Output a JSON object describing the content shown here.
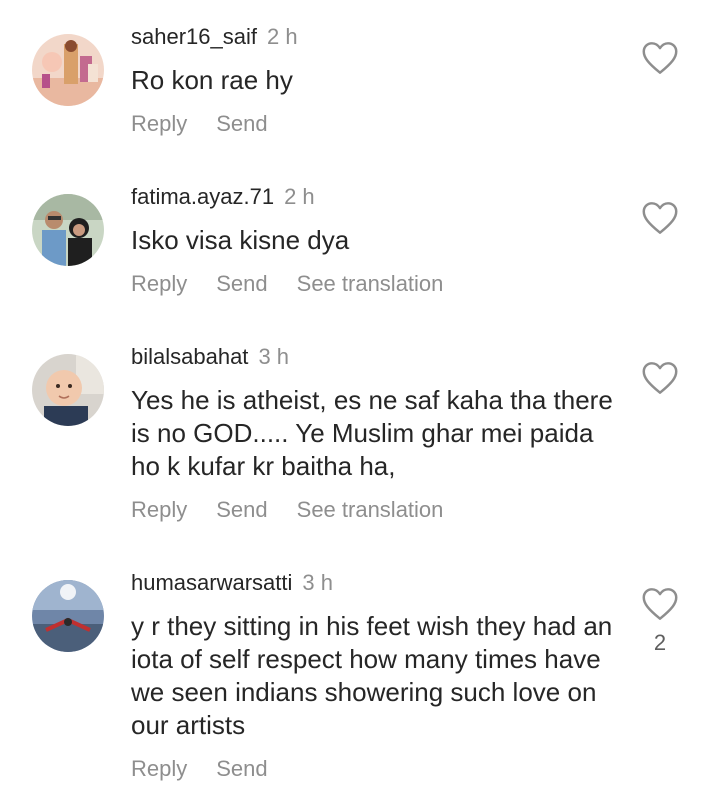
{
  "comments": [
    {
      "username": "saher16_saif",
      "time": "2 h",
      "text": "Ro kon rae hy",
      "actions": [
        "Reply",
        "Send"
      ],
      "like_count": ""
    },
    {
      "username": "fatima.ayaz.71",
      "time": "2 h",
      "text": "Isko visa kisne dya",
      "actions": [
        "Reply",
        "Send",
        "See translation"
      ],
      "like_count": ""
    },
    {
      "username": "bilalsabahat",
      "time": "3 h",
      "text": "Yes he is atheist,  es ne saf kaha tha there is no GOD..... Ye Muslim ghar mei paida ho k kufar kr baitha ha,",
      "actions": [
        "Reply",
        "Send",
        "See translation"
      ],
      "like_count": ""
    },
    {
      "username": "humasarwarsatti",
      "time": "3 h",
      "text": "y r they sitting in his feet wish they had an iota of self respect how many times have we seen indians  showering such love on our artists",
      "actions": [
        "Reply",
        "Send"
      ],
      "like_count": "2"
    }
  ],
  "icons": {
    "like": "heart-outline-icon"
  },
  "colors": {
    "text": "#262626",
    "secondary": "#8e8e8e"
  }
}
